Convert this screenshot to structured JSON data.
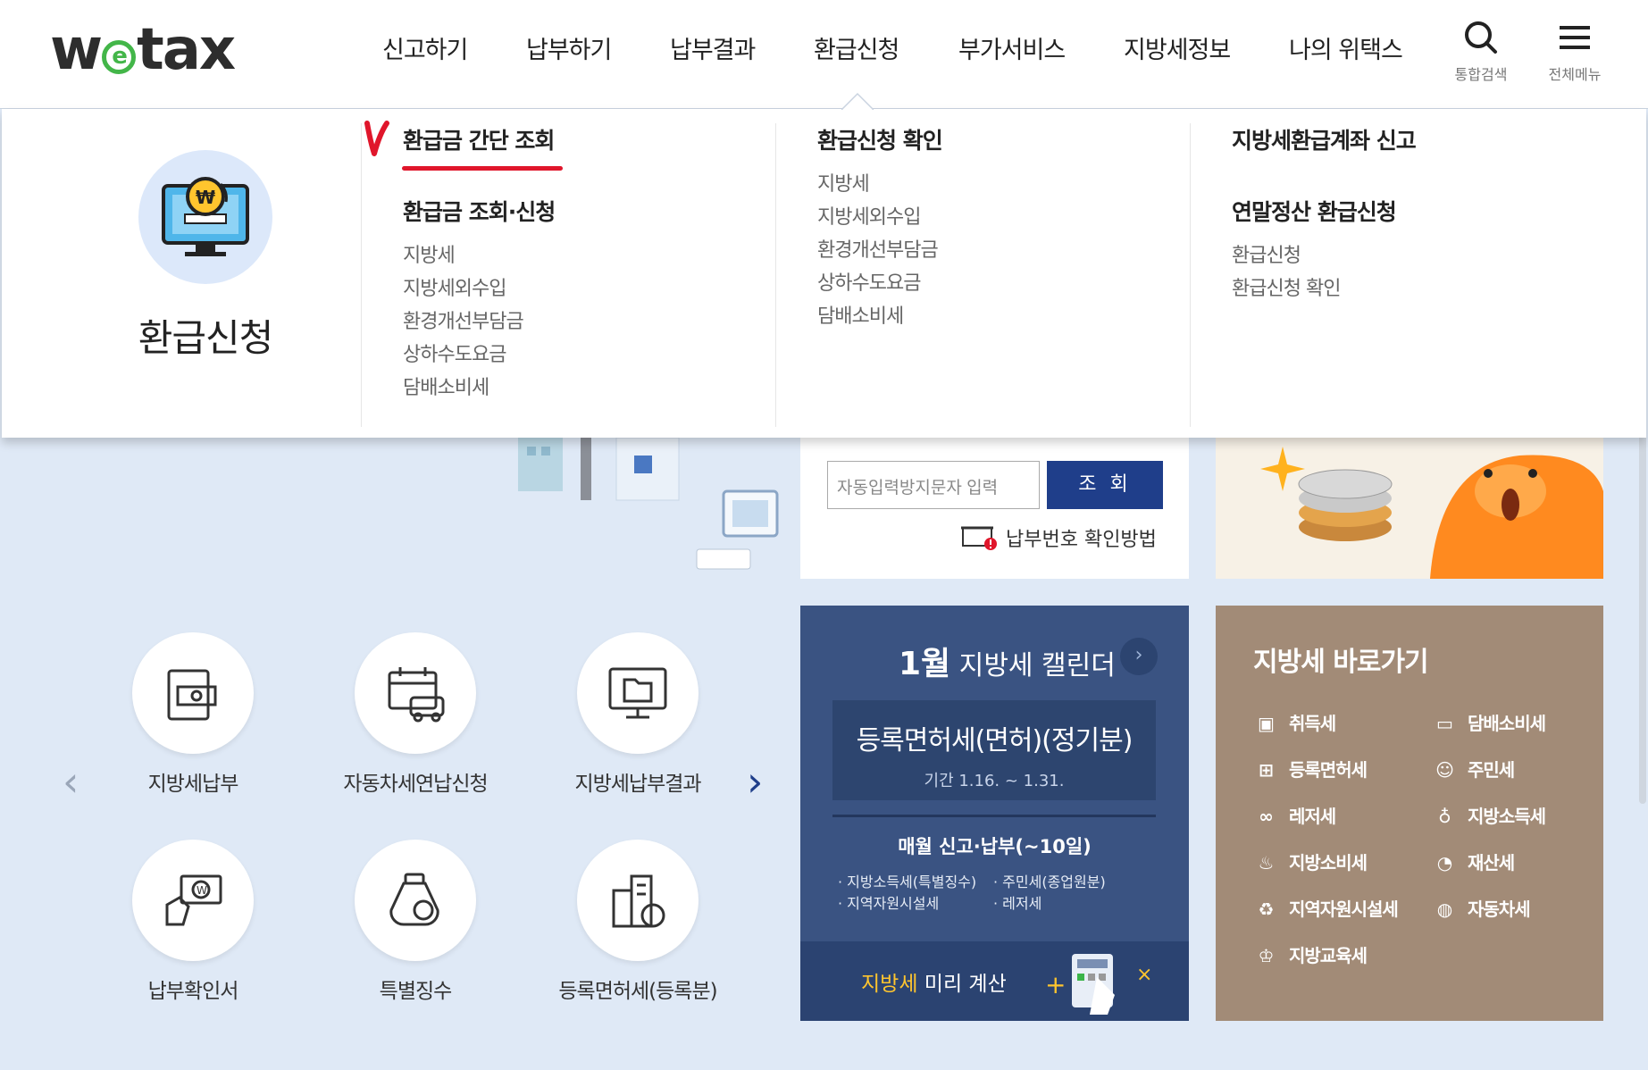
{
  "header": {
    "logo": {
      "w": "w",
      "e": "e",
      "tax": "tax"
    },
    "nav": [
      "신고하기",
      "납부하기",
      "납부결과",
      "환급신청",
      "부가서비스",
      "지방세정보",
      "나의 위택스"
    ],
    "search_label": "통합검색",
    "menu_label": "전체메뉴"
  },
  "mega": {
    "title": "환급신청",
    "col1": {
      "head1": "환급금 간단 조회",
      "head2": "환급금 조회·신청",
      "items": [
        "지방세",
        "지방세외수입",
        "환경개선부담금",
        "상하수도요금",
        "담배소비세"
      ]
    },
    "col2": {
      "head": "환급신청 확인",
      "items": [
        "지방세",
        "지방세외수입",
        "환경개선부담금",
        "상하수도요금",
        "담배소비세"
      ]
    },
    "col3": {
      "head1": "지방세환급계좌 신고",
      "head2": "연말정산 환급신청",
      "items": [
        "환급신청",
        "환급신청 확인"
      ]
    }
  },
  "lookup": {
    "captcha_placeholder": "자동입력방지문자 입력",
    "submit": "조 회",
    "paynum_help": "납부번호 확인방법"
  },
  "tiles": [
    "지방세납부",
    "자동차세연납신청",
    "지방세납부결과",
    "납부확인서",
    "특별징수",
    "등록면허세(등록분)"
  ],
  "calendar": {
    "month": "1월",
    "title": "지방세 캘린더",
    "featured": "등록면허세(면허)(정기분)",
    "period": "기간 1.16. ~ 1.31.",
    "monthly": "매월 신고·납부(~10일)",
    "left_items": [
      "· 지방소득세(특별징수)",
      "· 지역자원시설세"
    ],
    "right_items": [
      "· 주민세(종업원분)",
      "· 레저세"
    ],
    "calc_highlight": "지방세",
    "calc_rest": " 미리 계산"
  },
  "quick": {
    "title": "지방세 바로가기",
    "items": [
      "취득세",
      "담배소비세",
      "등록면허세",
      "주민세",
      "레저세",
      "지방소득세",
      "지방소비세",
      "재산세",
      "지역자원시설세",
      "자동차세",
      "지방교육세"
    ]
  }
}
